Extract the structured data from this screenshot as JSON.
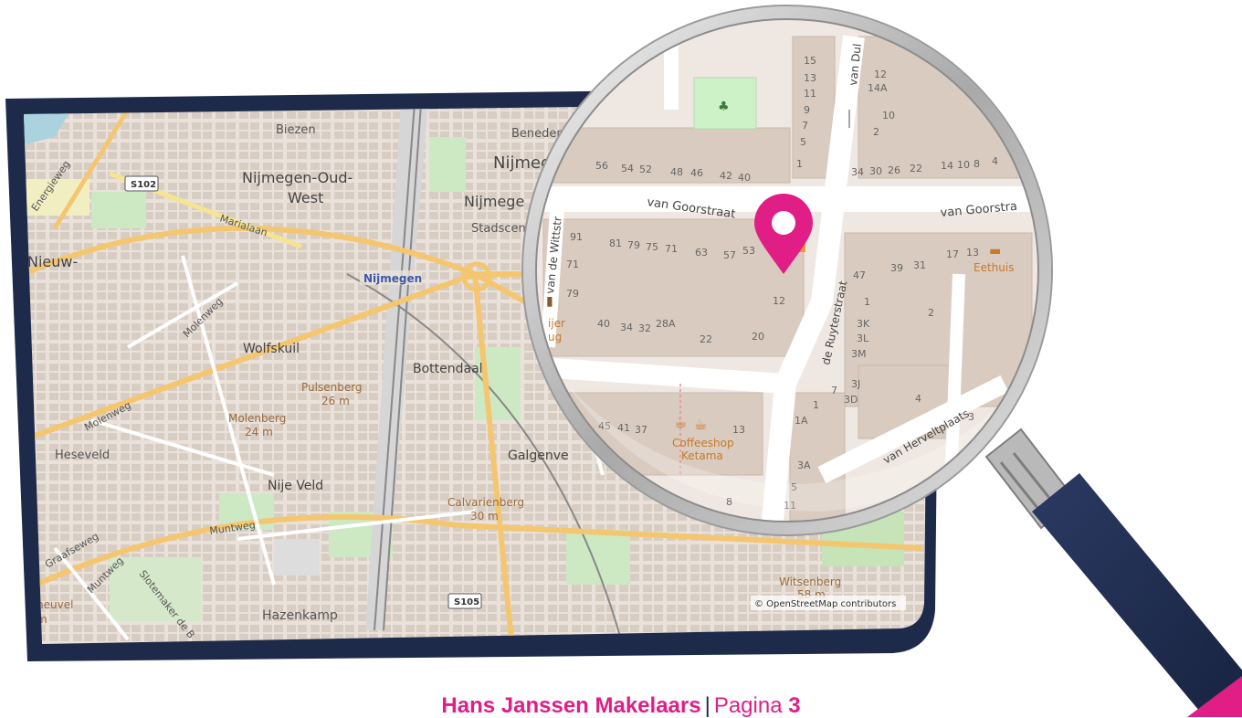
{
  "overview_map": {
    "labels": {
      "biezen": "Biezen",
      "beneden": "Beneden",
      "nijmegen": "Nijmeg",
      "oud_west_1": "Nijmegen-Oud-",
      "oud_west_2": "West",
      "nijmegen_2": "Nijmege",
      "stadscentrum": "Stadscen",
      "nieuw": "Nieuw-",
      "energieweg": "Energieweg",
      "marialaan": "Marialaan",
      "station": "Nijmegen",
      "molenweg": "Molenweg",
      "molenweg_2": "Molenweg",
      "wolfskuil": "Wolfskuil",
      "bottendaal": "Bottendaal",
      "pulsenberg": "Pulsenberg",
      "pulsenberg_h": "26 m",
      "molenberg": "Molenberg",
      "molenberg_h": "24 m",
      "heseveld": "Heseveld",
      "galgenveld": "Galgenve",
      "nije_veld": "Nije Veld",
      "calvarienberg": "Calvarienberg",
      "calvarienberg_h": "30 m",
      "muntweg": "Muntweg",
      "graafseweg": "Graafseweg",
      "muntweg_2": "Muntweg",
      "slotemaker": "Slotemaker de B",
      "heuvel": "heuvel",
      "heuvel_h": "m",
      "hazenkamp": "Hazenkamp",
      "witsenberg": "Witsenberg",
      "witsenberg_h": "58 m"
    },
    "shields": {
      "s102": "S102",
      "s105": "S105"
    },
    "attribution": "© OpenStreetMap contributors"
  },
  "magnifier": {
    "streets": {
      "van_goorstraat_left": "van Goorstraat",
      "van_goorstraat_right": "van Goorstra",
      "de_ruyterstraat": "de Ruyterstraat",
      "van_wittstraat": "van de Wittstr",
      "van_herveltplaats": "van Herveltplaats",
      "van_dul": "van Dul"
    },
    "house_numbers": {
      "n15": "15",
      "n13": "13",
      "n11": "11",
      "n9": "9",
      "n7": "7",
      "n5": "5",
      "n1": "1",
      "n56": "56",
      "n54": "54",
      "n52": "52",
      "n48": "48",
      "n46": "46",
      "n42": "42",
      "n40": "40",
      "r12": "12",
      "r14a": "14A",
      "r10": "10",
      "r2": "2",
      "r34": "34",
      "r30": "30",
      "r26": "26",
      "r22": "22",
      "r14": "14",
      "r10b": "10",
      "r8": "8",
      "r4": "4",
      "m91": "91",
      "m81": "81",
      "m79": "79",
      "m75": "75",
      "m71": "71",
      "m63": "63",
      "m57": "57",
      "m53": "53",
      "m71b": "71",
      "m79b": "79",
      "m40": "40",
      "m34": "34",
      "m32": "32",
      "m28a": "28A",
      "m22": "22",
      "m20": "20",
      "m12": "12",
      "e17": "17",
      "e13": "13",
      "e47": "47",
      "e39": "39",
      "e31": "31",
      "e1": "1",
      "e3k": "3K",
      "e3l": "3L",
      "e3m": "3M",
      "e2": "2",
      "e7": "7",
      "e3j": "3J",
      "e3d": "3D",
      "e1b": "1",
      "e4": "4",
      "e3": "3",
      "e1a": "1A",
      "e3a": "3A",
      "e5": "5",
      "e11": "11",
      "b45": "45",
      "b41": "41",
      "b37": "37",
      "b13": "13",
      "b8": "8"
    },
    "pois": {
      "eethuis": "Eethuis",
      "coffeeshop_1": "Coffeeshop",
      "coffeeshop_2": "Ketama",
      "wijer": "ijer",
      "ug": "ug"
    },
    "marker_color": "#e01e86"
  },
  "footer": {
    "brand": "Hans Janssen Makelaars",
    "separator": "|",
    "page_label": "Pagina",
    "page_number": "3"
  },
  "colors": {
    "frame": "#1d2a4a",
    "accent": "#e01e86",
    "map_base": "#efe7e1",
    "building": "#d9cbbf",
    "road": "#ffffff",
    "major_road": "#f8d9a3",
    "park": "#cde9c4"
  }
}
